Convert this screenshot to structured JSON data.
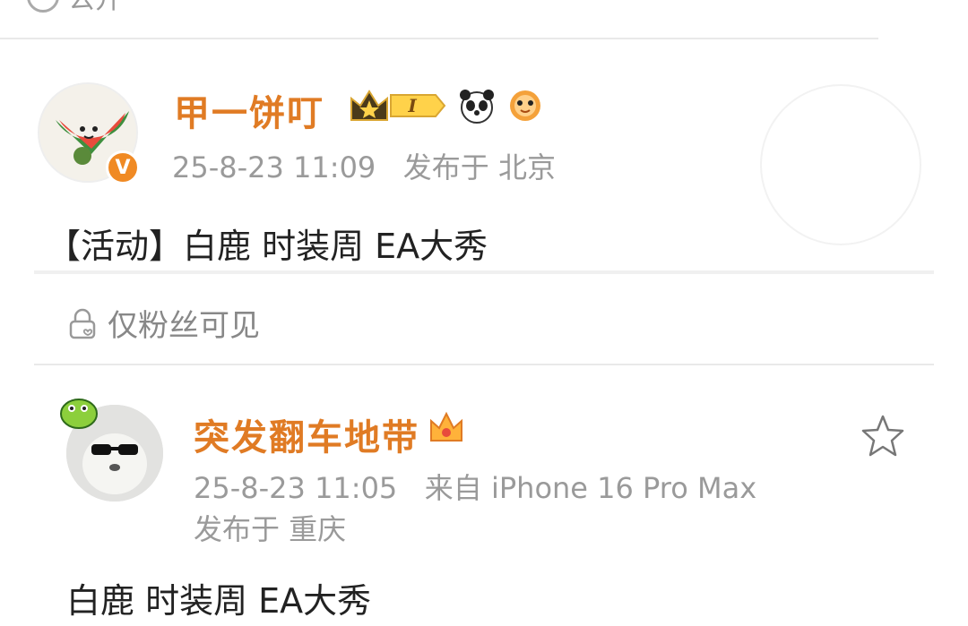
{
  "top": {
    "visibility_label": "公开"
  },
  "post1": {
    "author": "甲一饼叮",
    "level_badge": "I",
    "timestamp": "25-8-23 11:09",
    "location": "发布于 北京",
    "text": "【活动】白鹿 时装周 EA大秀",
    "verified_mark": "V",
    "badge_icons": [
      "crown-icon",
      "panda-icon",
      "puffer-fish-icon"
    ]
  },
  "visibility_notice": {
    "label": "仅粉丝可见"
  },
  "post2": {
    "author": "突发翻车地带",
    "timestamp": "25-8-23 11:05",
    "source": "来自 iPhone 16 Pro Max",
    "location": "发布于 重庆",
    "text": "白鹿 时装周 EA大秀"
  },
  "colors": {
    "accent": "#e07b24",
    "verified": "#f08a24",
    "meta": "#9a9a9a"
  }
}
